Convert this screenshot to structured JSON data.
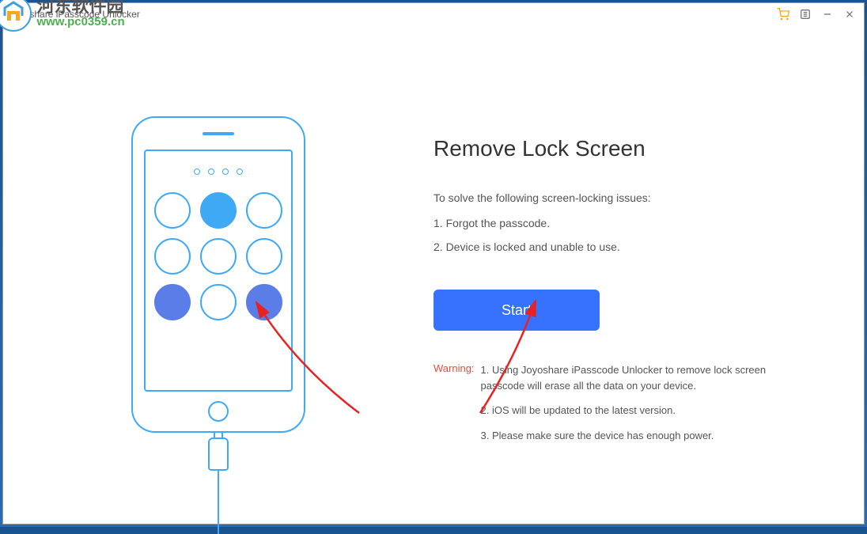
{
  "window": {
    "title": "Joyoshare iPasscode Unlocker"
  },
  "watermark": {
    "text_cn": "河东软件园",
    "url": "www.pc0359.cn"
  },
  "main": {
    "heading": "Remove Lock Screen",
    "subtitle": "To solve the following screen-locking issues:",
    "issues": [
      "1. Forgot the passcode.",
      "2. Device is locked and unable to use."
    ],
    "start_label": "Start",
    "warning_label": "Warning:",
    "warnings": [
      "1. Using Joyoshare iPasscode Unlocker to remove lock screen passcode will erase all the data on your device.",
      "2. iOS will be updated to the latest version.",
      "3. Please make sure the device has enough power."
    ]
  }
}
